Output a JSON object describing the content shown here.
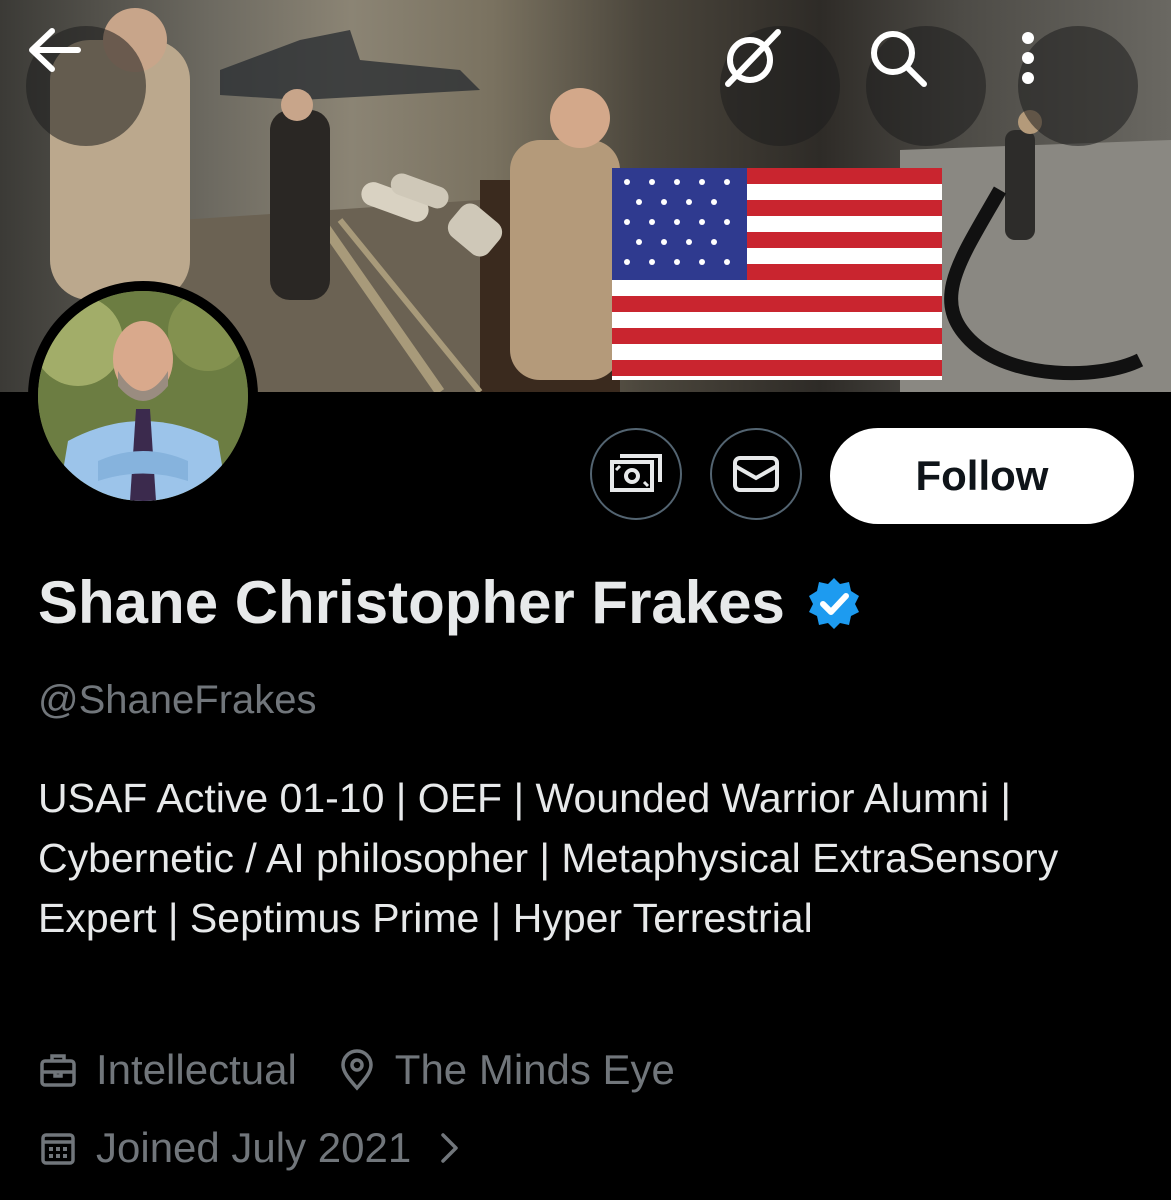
{
  "header": {
    "back_icon": "arrow-left-icon",
    "grok_icon": "grok-icon",
    "search_icon": "search-icon",
    "more_icon": "more-vertical-icon"
  },
  "profile": {
    "display_name": "Shane Christopher Frakes",
    "verified": true,
    "verified_color": "#1d9bf0",
    "handle": "@ShaneFrakes",
    "bio": "USAF Active 01-10 | OEF | Wounded Warrior Alumni | Cybernetic / AI philosopher | Metaphysical ExtraSensory Expert | Septimus Prime | Hyper Terrestrial",
    "profession": "Intellectual",
    "location": "The Minds Eye",
    "joined": "Joined July 2021"
  },
  "actions": {
    "tip_icon": "money-icon",
    "message_icon": "envelope-icon",
    "follow_label": "Follow"
  }
}
